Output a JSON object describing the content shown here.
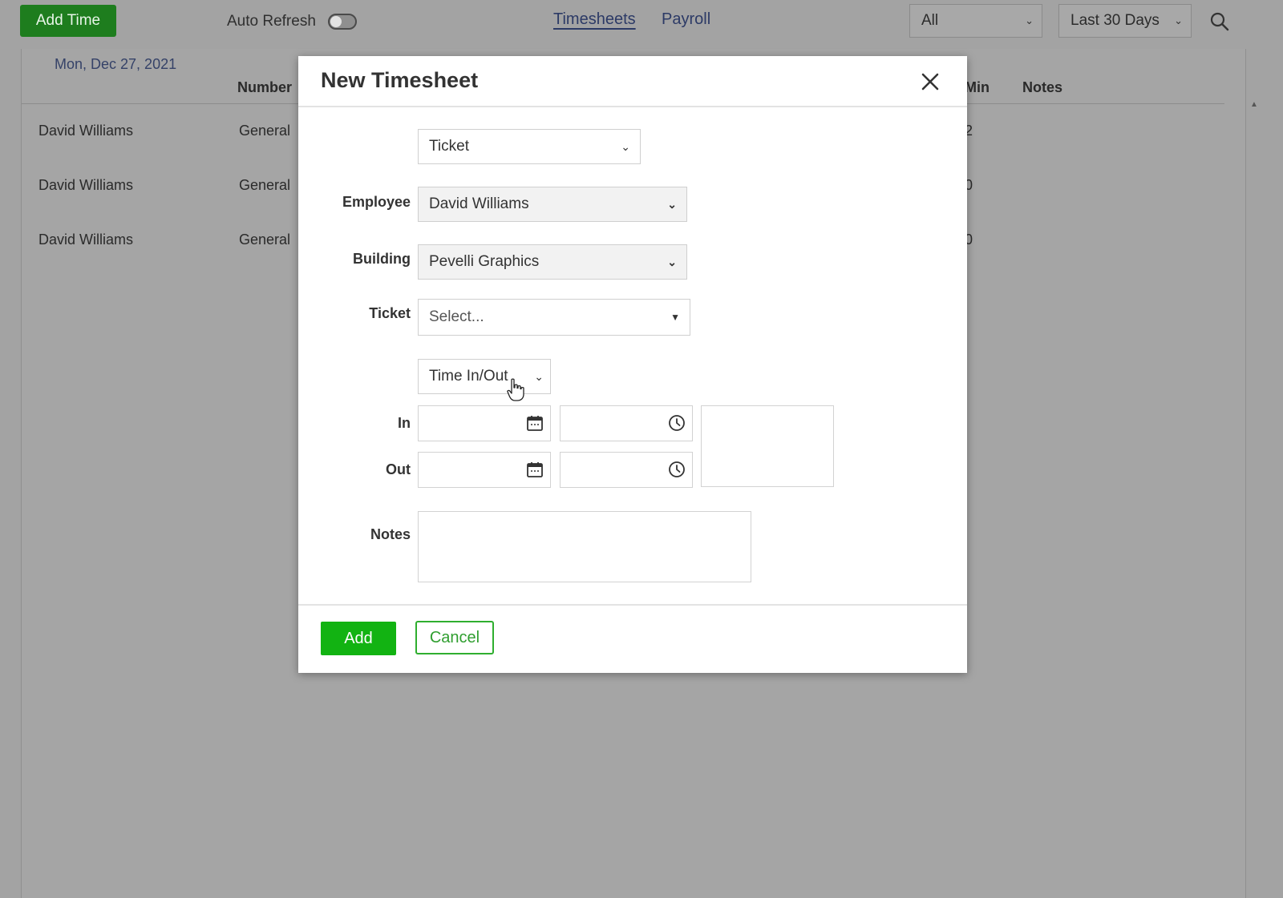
{
  "toolbar": {
    "add_time_label": "Add Time",
    "auto_refresh_label": "Auto Refresh",
    "auto_refresh_on": false,
    "tabs": [
      {
        "label": "Timesheets",
        "active": true
      },
      {
        "label": "Payroll",
        "active": false
      }
    ],
    "filter_scope": "All",
    "filter_range": "Last 30 Days",
    "search_icon": "search-icon"
  },
  "list": {
    "date_header": "Mon, Dec 27, 2021",
    "columns": {
      "number": "Number",
      "min": "Min",
      "notes": "Notes"
    },
    "rows": [
      {
        "employee": "David Williams",
        "category": "General",
        "min": "2"
      },
      {
        "employee": "David Williams",
        "category": "General",
        "min": "0"
      },
      {
        "employee": "David Williams",
        "category": "General",
        "min": "0"
      }
    ]
  },
  "modal": {
    "title": "New Timesheet",
    "close_icon": "close-icon",
    "type_select": "Ticket",
    "employee_label": "Employee",
    "employee_value": "David Williams",
    "building_label": "Building",
    "building_value": "Pevelli Graphics",
    "ticket_label": "Ticket",
    "ticket_placeholder": "Select...",
    "time_mode_select": "Time In/Out",
    "in_label": "In",
    "out_label": "Out",
    "notes_label": "Notes",
    "add_button": "Add",
    "cancel_button": "Cancel"
  },
  "colors": {
    "accent_green": "#12b312",
    "dark_green": "#1e7d1e",
    "overlay_gray": "#a3a3a3",
    "nav_blue": "#2c3a66"
  }
}
